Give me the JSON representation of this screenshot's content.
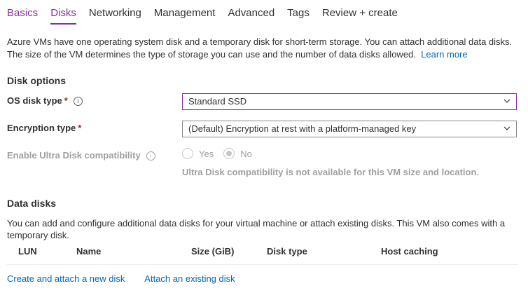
{
  "tabs": [
    {
      "label": "Basics"
    },
    {
      "label": "Disks"
    },
    {
      "label": "Networking"
    },
    {
      "label": "Management"
    },
    {
      "label": "Advanced"
    },
    {
      "label": "Tags"
    },
    {
      "label": "Review + create"
    }
  ],
  "intro": {
    "text": "Azure VMs have one operating system disk and a temporary disk for short-term storage. You can attach additional data disks. The size of the VM determines the type of storage you can use and the number of data disks allowed.",
    "link": "Learn more"
  },
  "disk_options": {
    "title": "Disk options",
    "os_disk_type": {
      "label": "OS disk type",
      "required": "*",
      "value": "Standard SSD"
    },
    "encryption_type": {
      "label": "Encryption type",
      "required": "*",
      "value": "(Default) Encryption at rest with a platform-managed key"
    },
    "ultra_disk": {
      "label": "Enable Ultra Disk compatibility",
      "options": [
        "Yes",
        "No"
      ],
      "selected": "No",
      "note": "Ultra Disk compatibility is not available for this VM size and location."
    }
  },
  "data_disks": {
    "title": "Data disks",
    "description": "You can add and configure additional data disks for your virtual machine or attach existing disks. This VM also comes with a temporary disk.",
    "columns": [
      "LUN",
      "Name",
      "Size (GiB)",
      "Disk type",
      "Host caching"
    ],
    "actions": [
      "Create and attach a new disk",
      "Attach an existing disk"
    ]
  },
  "colors": {
    "accent": "#8a2da5",
    "link": "#0067b8",
    "required": "#a4262c",
    "disabled": "#a19f9d"
  }
}
